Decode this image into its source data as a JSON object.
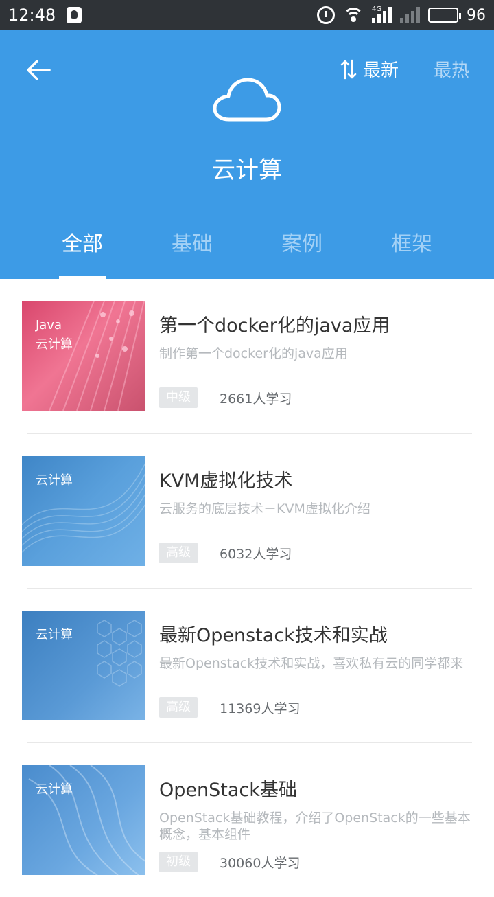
{
  "status_bar": {
    "time": "12:48",
    "network": "4G",
    "battery": "96"
  },
  "header": {
    "title": "云计算",
    "sort_newest": "最新",
    "sort_hottest": "最热",
    "accent_color": "#3d9be6"
  },
  "tabs": [
    {
      "label": "全部",
      "active": true
    },
    {
      "label": "基础",
      "active": false
    },
    {
      "label": "案例",
      "active": false
    },
    {
      "label": "框架",
      "active": false
    }
  ],
  "courses": [
    {
      "thumb_line1": "Java",
      "thumb_line2": "云计算",
      "title": "第一个docker化的java应用",
      "desc": "制作第一个docker化的java应用",
      "level": "中级",
      "learners": "2661人学习"
    },
    {
      "thumb_line1": "云计算",
      "title": "KVM虚拟化技术",
      "desc": "云服务的底层技术－KVM虚拟化介绍",
      "level": "高级",
      "learners": "6032人学习"
    },
    {
      "thumb_line1": "云计算",
      "title": "最新Openstack技术和实战",
      "desc": "最新Openstack技术和实战，喜欢私有云的同学都来",
      "level": "高级",
      "learners": "11369人学习"
    },
    {
      "thumb_line1": "云计算",
      "title": "OpenStack基础",
      "desc": "OpenStack基础教程，介绍了OpenStack的一些基本概念，基本组件",
      "level": "初级",
      "learners": "30060人学习"
    }
  ]
}
